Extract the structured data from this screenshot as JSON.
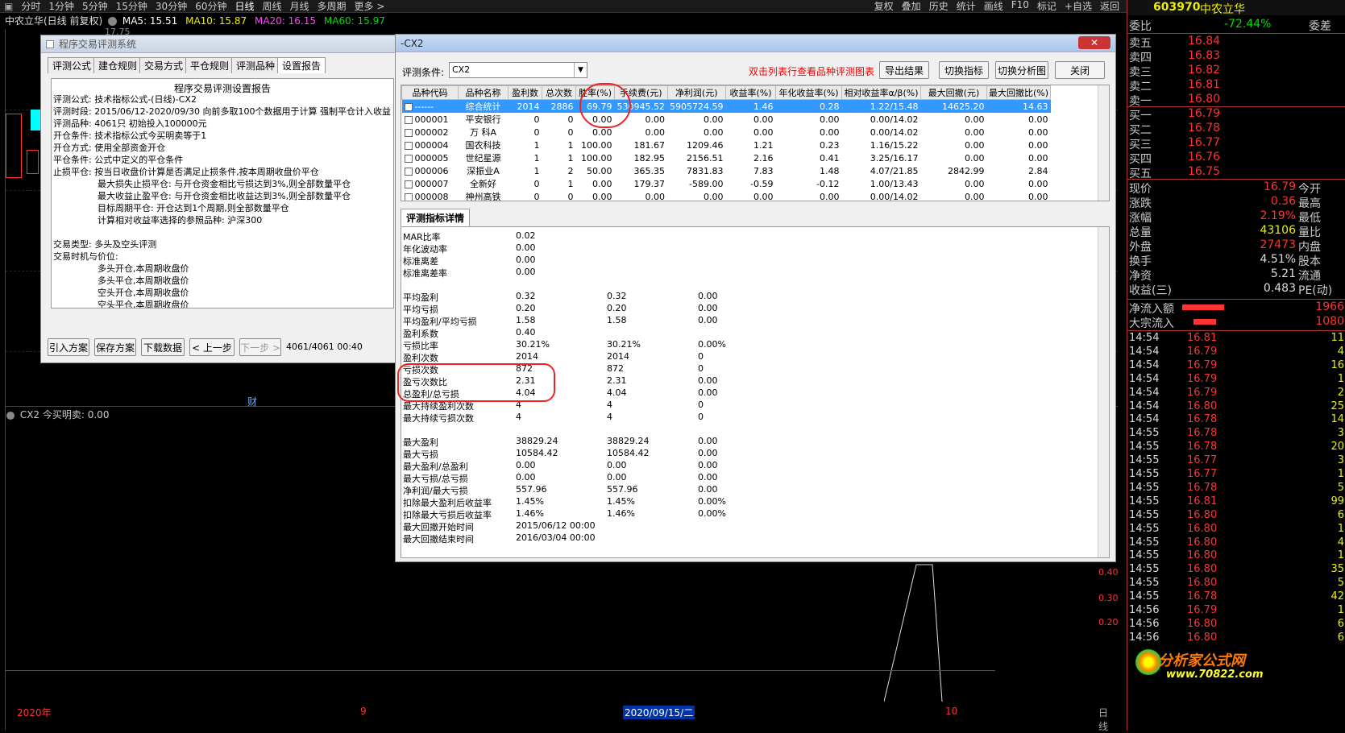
{
  "toolbar": {
    "timeframes": [
      "分时",
      "1分钟",
      "5分钟",
      "15分钟",
      "30分钟",
      "60分钟",
      "日线",
      "周线",
      "月线",
      "多周期",
      "更多 >"
    ],
    "active_index": 6,
    "right_items": [
      "复权",
      "叠加",
      "历史",
      "统计",
      "画线",
      "F10",
      "标记",
      "+自选",
      "返回"
    ]
  },
  "chart": {
    "title": "中农立华(日线 前复权)",
    "ma5": "MA5: 15.51",
    "ma10": "MA10: 15.87",
    "ma20": "MA20: 16.15",
    "ma60": "MA60: 15.97",
    "price_label": "17.75",
    "sub_indicator": "CX2 今买明卖: 0.00",
    "marker": "财",
    "axis_ticks": [
      "0.40",
      "0.30",
      "0.20"
    ],
    "bottom_labels": [
      "2020年",
      "9",
      "2020/09/15/二",
      "10"
    ],
    "rt_bottom_label": "日线"
  },
  "right_panel": {
    "code": "603970",
    "name": "中农立华",
    "weibi_label": "委比",
    "weibi_value": "-72.44%",
    "weicha_label": "委差",
    "asks": [
      {
        "label": "卖五",
        "price": "16.84"
      },
      {
        "label": "卖四",
        "price": "16.83"
      },
      {
        "label": "卖三",
        "price": "16.82"
      },
      {
        "label": "卖二",
        "price": "16.81"
      },
      {
        "label": "卖一",
        "price": "16.80"
      }
    ],
    "bids": [
      {
        "label": "买一",
        "price": "16.79"
      },
      {
        "label": "买二",
        "price": "16.78"
      },
      {
        "label": "买三",
        "price": "16.77"
      },
      {
        "label": "买四",
        "price": "16.76"
      },
      {
        "label": "买五",
        "price": "16.75"
      }
    ],
    "stats": [
      {
        "l": "现价",
        "v": "16.79",
        "r": "今开",
        "c": "#f33"
      },
      {
        "l": "涨跌",
        "v": "0.36",
        "r": "最高",
        "c": "#f33"
      },
      {
        "l": "涨幅",
        "v": "2.19%",
        "r": "最低",
        "c": "#f33"
      },
      {
        "l": "总量",
        "v": "43106",
        "r": "量比",
        "c": "#ee0"
      },
      {
        "l": "外盘",
        "v": "27473",
        "r": "内盘",
        "c": "#f33"
      },
      {
        "l": "换手",
        "v": "4.51%",
        "r": "股本",
        "c": "#ddd"
      },
      {
        "l": "净资",
        "v": "5.21",
        "r": "流通",
        "c": "#ddd"
      },
      {
        "l": "收益(三)",
        "v": "0.483",
        "r": "PE(动)",
        "c": "#ddd"
      }
    ],
    "flows": [
      {
        "l": "净流入额",
        "v": "1966"
      },
      {
        "l": "大宗流入",
        "v": "1080"
      }
    ],
    "ticks": [
      {
        "t": "14:54",
        "p": "16.81",
        "v": "11"
      },
      {
        "t": "14:54",
        "p": "16.79",
        "v": "4"
      },
      {
        "t": "14:54",
        "p": "16.79",
        "v": "16"
      },
      {
        "t": "14:54",
        "p": "16.79",
        "v": "1"
      },
      {
        "t": "14:54",
        "p": "16.79",
        "v": "2"
      },
      {
        "t": "14:54",
        "p": "16.80",
        "v": "25"
      },
      {
        "t": "14:54",
        "p": "16.78",
        "v": "14"
      },
      {
        "t": "14:55",
        "p": "16.78",
        "v": "3"
      },
      {
        "t": "14:55",
        "p": "16.78",
        "v": "20"
      },
      {
        "t": "14:55",
        "p": "16.77",
        "v": "3"
      },
      {
        "t": "14:55",
        "p": "16.77",
        "v": "1"
      },
      {
        "t": "14:55",
        "p": "16.78",
        "v": "5"
      },
      {
        "t": "14:55",
        "p": "16.81",
        "v": "99"
      },
      {
        "t": "14:55",
        "p": "16.80",
        "v": "6"
      },
      {
        "t": "14:55",
        "p": "16.80",
        "v": "1"
      },
      {
        "t": "14:55",
        "p": "16.80",
        "v": "4"
      },
      {
        "t": "14:55",
        "p": "16.80",
        "v": "1"
      },
      {
        "t": "14:55",
        "p": "16.80",
        "v": "35"
      },
      {
        "t": "14:55",
        "p": "16.80",
        "v": "5"
      },
      {
        "t": "14:55",
        "p": "16.78",
        "v": "42"
      },
      {
        "t": "14:56",
        "p": "16.79",
        "v": "1"
      },
      {
        "t": "14:56",
        "p": "16.80",
        "v": "6"
      },
      {
        "t": "14:56",
        "p": "16.80",
        "v": "6"
      }
    ],
    "watermark_main": "分析家公式网",
    "watermark_url": "www.70822.com"
  },
  "left_win": {
    "title": "程序交易评测系统",
    "tabs": [
      "评测公式",
      "建仓规则",
      "交易方式",
      "平仓规则",
      "评测品种",
      "设置报告"
    ],
    "report_title": "程序交易评测设置报告",
    "lines": [
      "评测公式: 技术指标公式-(日线)-CX2",
      "评测时段: 2015/06/12-2020/09/30 向前多取100个数据用于计算 强制平仓计入收益",
      "评测品种: 4061只 初始投入100000元",
      "开仓条件: 技术指标公式今买明卖等于1",
      "开仓方式: 使用全部资金开仓",
      "平仓条件: 公式中定义的平仓条件",
      "止损平仓: 按当日收盘价计算是否满足止损条件,按本周期收盘价平仓",
      "　　　　　最大损失止损平仓: 与开仓资金相比亏损达到3%,则全部数量平仓",
      "　　　　　最大收益止盈平仓: 与开仓资金相比收益达到3%,则全部数量平仓",
      "　　　　　目标周期平仓: 开仓达到1个周期,则全部数量平仓",
      "　　　　　计算相对收益率选择的参照品种: 沪深300",
      "",
      "交易类型: 多头及空头评测",
      "交易时机与价位:",
      "　　　　　多头开仓,本周期收盘价",
      "　　　　　多头平仓,本周期收盘价",
      "　　　　　空头开仓,本周期收盘价",
      "　　　　　空头平仓,本周期收盘价"
    ],
    "buttons": [
      "引入方案",
      "保存方案",
      "下载数据",
      "< 上一步",
      "下一步 >"
    ],
    "status": "4061/4061 00:40"
  },
  "main_win": {
    "title": "-CX2",
    "cond_label": "评测条件:",
    "cond_value": "CX2",
    "hint": "双击列表行查看品种评测图表",
    "buttons": [
      "导出结果",
      "切换指标",
      "切换分析图",
      "关闭"
    ],
    "headers": [
      "品种代码",
      "品种名称",
      "盈利数",
      "总次数",
      "胜率(%)",
      "手续费(元)",
      "净利润(元)",
      "收益率(%)",
      "年化收益率(%)",
      "相对收益率α/β(%)",
      "最大回撤(元)",
      "最大回撤比(%)"
    ],
    "rows": [
      [
        "------",
        "综合统计",
        "2014",
        "2886",
        "69.79",
        "530945.52",
        "5905724.59",
        "1.46",
        "0.28",
        "1.22/15.48",
        "14625.20",
        "14.63"
      ],
      [
        "000001",
        "平安银行",
        "0",
        "0",
        "0.00",
        "0.00",
        "0.00",
        "0.00",
        "0.00",
        "0.00/14.02",
        "0.00",
        "0.00"
      ],
      [
        "000002",
        "万 科A",
        "0",
        "0",
        "0.00",
        "0.00",
        "0.00",
        "0.00",
        "0.00",
        "0.00/14.02",
        "0.00",
        "0.00"
      ],
      [
        "000004",
        "国农科技",
        "1",
        "1",
        "100.00",
        "181.67",
        "1209.46",
        "1.21",
        "0.23",
        "1.16/15.22",
        "0.00",
        "0.00"
      ],
      [
        "000005",
        "世纪星源",
        "1",
        "1",
        "100.00",
        "182.95",
        "2156.51",
        "2.16",
        "0.41",
        "3.25/16.17",
        "0.00",
        "0.00"
      ],
      [
        "000006",
        "深振业A",
        "1",
        "2",
        "50.00",
        "365.35",
        "7831.83",
        "7.83",
        "1.48",
        "4.07/21.85",
        "2842.99",
        "2.84"
      ],
      [
        "000007",
        "全新好",
        "0",
        "1",
        "0.00",
        "179.37",
        "-589.00",
        "-0.59",
        "-0.12",
        "1.00/13.43",
        "0.00",
        "0.00"
      ],
      [
        "000008",
        "神州高铁",
        "0",
        "0",
        "0.00",
        "0.00",
        "0.00",
        "0.00",
        "0.00",
        "0.00/14.02",
        "0.00",
        "0.00"
      ]
    ],
    "detail_tab": "评测指标详情",
    "details": [
      [
        "MAR比率",
        "0.02",
        "",
        ""
      ],
      [
        "年化波动率",
        "0.00",
        "",
        ""
      ],
      [
        "标准离差",
        "0.00",
        "",
        ""
      ],
      [
        "标准离差率",
        "0.00",
        "",
        ""
      ],
      [
        "",
        "",
        "",
        ""
      ],
      [
        "平均盈利",
        "0.32",
        "0.32",
        "0.00"
      ],
      [
        "平均亏损",
        "0.20",
        "0.20",
        "0.00"
      ],
      [
        "平均盈利/平均亏损",
        "1.58",
        "1.58",
        "0.00"
      ],
      [
        "盈利系数",
        "0.40",
        "",
        ""
      ],
      [
        "亏损比率",
        "30.21%",
        "30.21%",
        "0.00%"
      ],
      [
        "盈利次数",
        "2014",
        "2014",
        "0"
      ],
      [
        "亏损次数",
        "872",
        "872",
        "0"
      ],
      [
        "盈亏次数比",
        "2.31",
        "2.31",
        "0.00"
      ],
      [
        "总盈利/总亏损",
        "4.04",
        "4.04",
        "0.00"
      ],
      [
        "最大持续盈利次数",
        "4",
        "4",
        "0"
      ],
      [
        "最大持续亏损次数",
        "4",
        "4",
        "0"
      ],
      [
        "",
        "",
        "",
        ""
      ],
      [
        "最大盈利",
        "38829.24",
        "38829.24",
        "0.00"
      ],
      [
        "最大亏损",
        "10584.42",
        "10584.42",
        "0.00"
      ],
      [
        "最大盈利/总盈利",
        "0.00",
        "0.00",
        "0.00"
      ],
      [
        "最大亏损/总亏损",
        "0.00",
        "0.00",
        "0.00"
      ],
      [
        "净利润/最大亏损",
        "557.96",
        "557.96",
        "0.00"
      ],
      [
        "扣除最大盈利后收益率",
        "1.45%",
        "1.45%",
        "0.00%"
      ],
      [
        "扣除最大亏损后收益率",
        "1.46%",
        "1.46%",
        "0.00%"
      ],
      [
        "最大回撤开始时间",
        "2015/06/12 00:00",
        "",
        ""
      ],
      [
        "最大回撤结束时间",
        "2016/03/04 00:00",
        "",
        ""
      ]
    ]
  },
  "colors": {
    "red": "#ff3333",
    "yellow": "#eeee00",
    "green": "#00dd00",
    "cyan": "#00ffff",
    "magenta": "#ff44ff",
    "select_blue": "#3399ff"
  }
}
